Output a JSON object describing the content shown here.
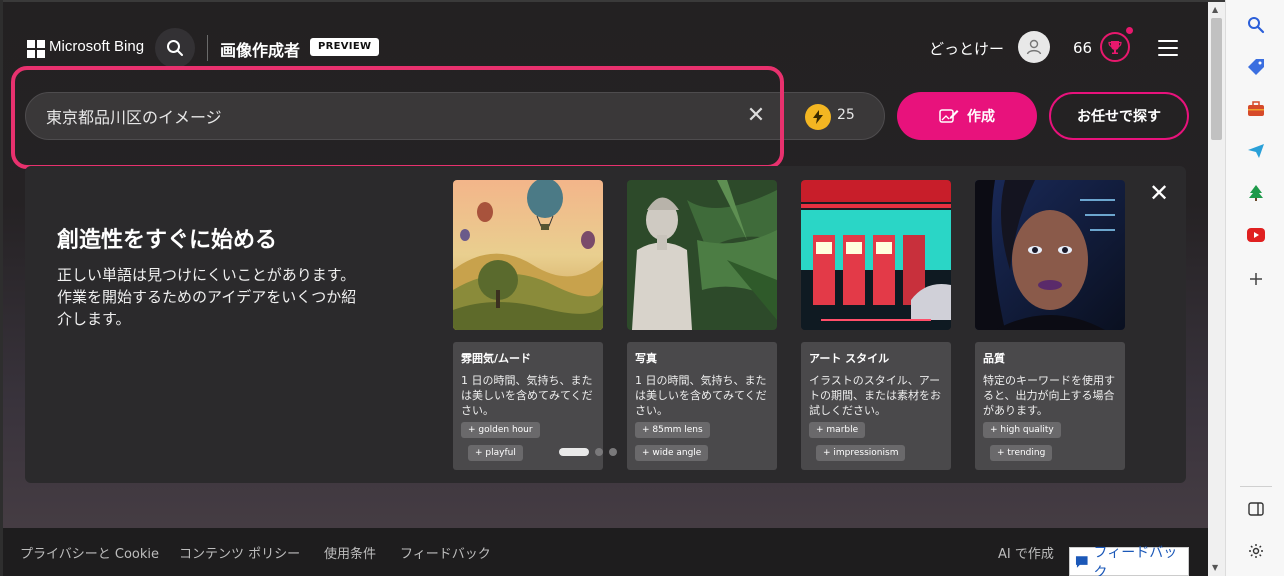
{
  "header": {
    "brand": "Microsoft Bing",
    "product": "画像作成者",
    "badge": "PREVIEW",
    "username": "どっとけー",
    "points": "66"
  },
  "search": {
    "value": "東京都品川区のイメージ",
    "boost_count": "25"
  },
  "buttons": {
    "create": "作成",
    "surprise": "お任せで探す"
  },
  "panel": {
    "title": "創造性をすぐに始める",
    "description": "正しい単語は見つけにくいことがあります。作業を開始するためのアイデアをいくつか紹介します。",
    "cards": [
      {
        "title": "雰囲気/ムード",
        "desc": "1 日の時間、気持ち、または美しいを含めてみてください。",
        "chips": [
          "golden hour",
          "playful"
        ]
      },
      {
        "title": "写真",
        "desc": "1 日の時間、気持ち、または美しいを含めてみてください。",
        "chips": [
          "85mm lens",
          "wide angle"
        ]
      },
      {
        "title": "アート スタイル",
        "desc": "イラストのスタイル、アートの期間、または素材をお試しください。",
        "chips": [
          "marble",
          "impressionism"
        ]
      },
      {
        "title": "品質",
        "desc": "特定のキーワードを使用すると、出力が向上する場合があります。",
        "chips": [
          "high quality",
          "trending"
        ]
      }
    ]
  },
  "footer": {
    "links": [
      "プライバシーと Cookie",
      "コンテンツ ポリシー",
      "使用条件",
      "フィードバック"
    ],
    "ai_note": "AI で作成",
    "feedback_button": "フィードバック"
  },
  "colors": {
    "accent": "#e8127c",
    "highlight": "#e8316e",
    "coin": "#f3b622"
  }
}
